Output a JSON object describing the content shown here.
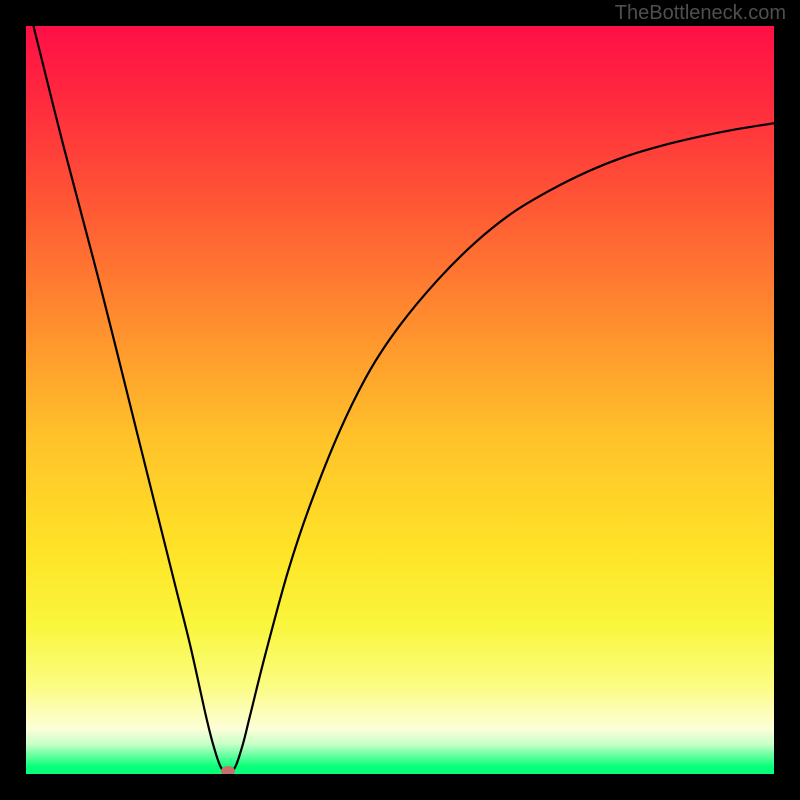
{
  "attribution": "TheBottleneck.com",
  "colors": {
    "frame": "#000000",
    "gradient_top": "#ff0f47",
    "gradient_mid": "#ffe327",
    "gradient_bottom": "#08ff7a",
    "curve": "#000000",
    "marker": "#c96f6d"
  },
  "chart_data": {
    "type": "line",
    "title": "",
    "xlabel": "",
    "ylabel": "",
    "xlim": [
      0,
      100
    ],
    "ylim": [
      0,
      100
    ],
    "grid": false,
    "legend_position": "none",
    "annotations": [
      "TheBottleneck.com"
    ],
    "series": [
      {
        "name": "curve",
        "x": [
          1,
          5,
          10,
          15,
          18,
          20,
          22,
          24,
          25,
          26,
          27,
          28,
          29,
          30,
          32,
          35,
          38,
          42,
          46,
          50,
          55,
          60,
          65,
          70,
          75,
          80,
          85,
          90,
          95,
          100
        ],
        "y": [
          100,
          84,
          65,
          45,
          33,
          25,
          17,
          8,
          4,
          1,
          0,
          1,
          4,
          8,
          16,
          27,
          36,
          46,
          54,
          60,
          66,
          71,
          75,
          78,
          80.5,
          82.5,
          84,
          85.2,
          86.2,
          87
        ]
      }
    ],
    "marker": {
      "x": 27,
      "y": 0
    },
    "notes": "Axes are unlabeled; values are estimated on a 0–100 normalized scale read from pixel positions. y is measured upward from the bottom of the plot area."
  }
}
